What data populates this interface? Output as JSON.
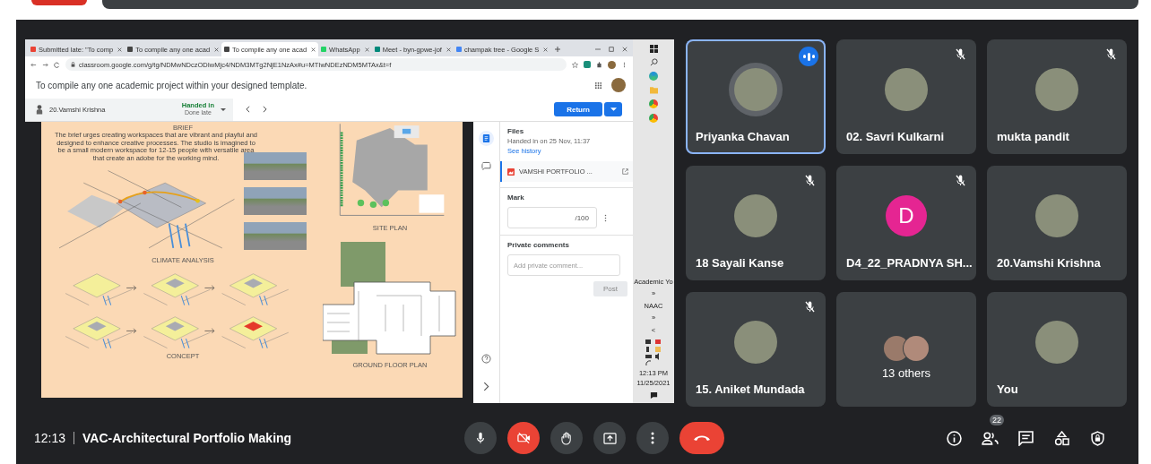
{
  "browser": {
    "tabs": [
      {
        "label": "Submitted late: \"To comp",
        "selected": false,
        "kind": "mail"
      },
      {
        "label": "To compile any one acad",
        "selected": false,
        "kind": "classroom"
      },
      {
        "label": "To compile any one acad",
        "selected": true,
        "kind": "classroom"
      },
      {
        "label": "WhatsApp",
        "selected": false,
        "kind": "whatsapp"
      },
      {
        "label": "Meet - byn-gpwe-jof",
        "selected": false,
        "kind": "meet"
      },
      {
        "label": "champak tree - Google S",
        "selected": false,
        "kind": "google"
      }
    ],
    "url": "classroom.google.com/g/tg/NDMwNDczODIwMjc4/NDM3MTg2NjE1NzAx#u=MTIwNDEzNDM5MTAx&t=f"
  },
  "assignment": {
    "title": "To compile any one academic project within your designed template.",
    "student": "20.Vamshi Krishna",
    "status": "Handed in",
    "substatus": "Done late",
    "return_button": "Return"
  },
  "poster": {
    "brief_heading": "BRIEF",
    "brief": "The brief urges creating workspaces that are vibrant and playful and designed to enhance creative processes. The studio is imagined to be a small modern workspace for 12-15 people with versatile area that create an adobe for the working mind.",
    "labels": [
      "CLIMATE ANALYSIS",
      "SITE PLAN",
      "CONCEPT",
      "GROUND FLOOR PLAN"
    ]
  },
  "files_panel": {
    "heading": "Files",
    "handed_in": "Handed in on 25 Nov, 11:37",
    "history_link": "See history",
    "file": "VAMSHI PORTFOLIO ...",
    "mark_label": "Mark",
    "mark_suffix": "/100",
    "comments_heading": "Private comments",
    "comment_placeholder": "Add private comment...",
    "post_button": "Post"
  },
  "taskbar": {
    "toolbars": [
      "Academic Yo",
      "»",
      "NAAC",
      "»"
    ],
    "chevron": "<",
    "time": "12:13 PM",
    "date": "11/25/2021"
  },
  "participants": [
    {
      "name": "Priyanka Chavan",
      "muted": false,
      "speaking": true,
      "kind": "photo"
    },
    {
      "name": "02. Savri Kulkarni",
      "muted": true,
      "speaking": false,
      "kind": "photo"
    },
    {
      "name": "mukta pandit",
      "muted": true,
      "speaking": false,
      "kind": "photo"
    },
    {
      "name": "18 Sayali Kanse",
      "muted": true,
      "speaking": false,
      "kind": "photo"
    },
    {
      "name": "D4_22_PRADNYA SH...",
      "muted": true,
      "speaking": false,
      "kind": "letter",
      "letter": "D",
      "color": "#e52592"
    },
    {
      "name": "20.Vamshi Krishna",
      "muted": false,
      "speaking": false,
      "kind": "photo"
    },
    {
      "name": "15. Aniket Mundada",
      "muted": true,
      "speaking": false,
      "kind": "photo"
    },
    {
      "name": "13 others",
      "muted": false,
      "speaking": false,
      "kind": "group"
    },
    {
      "name": "You",
      "muted": false,
      "speaking": false,
      "kind": "photo"
    }
  ],
  "meeting": {
    "time": "12:13",
    "title": "VAC-Architectural Portfolio Making",
    "people_count": "22"
  },
  "controls": [
    {
      "kind": "mic",
      "off": false
    },
    {
      "kind": "camera",
      "off": true
    },
    {
      "kind": "hand",
      "off": false
    },
    {
      "kind": "present",
      "off": false
    },
    {
      "kind": "more",
      "off": false
    },
    {
      "kind": "hangup"
    }
  ],
  "side_buttons": [
    {
      "kind": "info"
    },
    {
      "kind": "people"
    },
    {
      "kind": "chat"
    },
    {
      "kind": "activities"
    },
    {
      "kind": "safety"
    }
  ]
}
